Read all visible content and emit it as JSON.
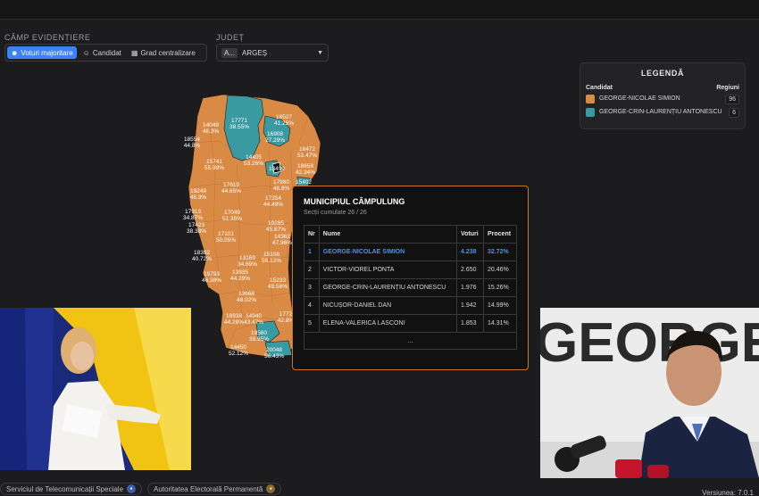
{
  "controls": {
    "camp_label": "CÂMP EVIDENȚIERE",
    "options": [
      {
        "label": "Voturi majoritare",
        "icon": "people-icon",
        "active": true
      },
      {
        "label": "Candidat",
        "icon": "person-icon",
        "active": false
      },
      {
        "label": "Grad centralizare",
        "icon": "calendar-icon",
        "active": false
      }
    ],
    "judet_label": "JUDEȚ",
    "judet_code": "A...",
    "judet_value": "ARGEȘ"
  },
  "legend": {
    "title": "LEGENDĂ",
    "col_candidate": "Candidat",
    "col_regions": "Regiuni",
    "items": [
      {
        "name": "GEORGE-NICOLAE SIMION",
        "count": "96",
        "color": "#d98a45"
      },
      {
        "name": "GEORGE-CRIN-LAURENȚIU ANTONESCU",
        "count": "6",
        "color": "#3a9aa2"
      }
    ]
  },
  "map_labels": [
    {
      "v": "14049",
      "p": "48.3%"
    },
    {
      "v": "17771",
      "p": "38.55%"
    },
    {
      "v": "18527",
      "p": "41.25%"
    },
    {
      "v": "18554",
      "p": "44.8%"
    },
    {
      "v": "16908",
      "p": "27.29%"
    },
    {
      "v": "16472",
      "p": "53.47%"
    },
    {
      "v": "15741",
      "p": "55.99%"
    },
    {
      "v": "14405",
      "p": "53.26%"
    },
    {
      "v": "13490",
      "p": ""
    },
    {
      "v": "18658",
      "p": "42.34%"
    },
    {
      "v": "17619",
      "p": "44.65%"
    },
    {
      "v": "17960",
      "p": "46.8%"
    },
    {
      "v": "15402",
      "p": ""
    },
    {
      "v": "19249",
      "p": "48.9%"
    },
    {
      "v": "17254",
      "p": "44.49%"
    },
    {
      "v": "17913",
      "p": "34.87%"
    },
    {
      "v": "17049",
      "p": "51.35%"
    },
    {
      "v": "19285",
      "p": "45.67%"
    },
    {
      "v": "17423",
      "p": "38.38%"
    },
    {
      "v": "17101",
      "p": "50.05%"
    },
    {
      "v": "14362",
      "p": "47.96%"
    },
    {
      "v": "18392",
      "p": "40.72%"
    },
    {
      "v": "13169",
      "p": "34.69%"
    },
    {
      "v": "15108",
      "p": "56.12%"
    },
    {
      "v": "19793",
      "p": "46.38%"
    },
    {
      "v": "13935",
      "p": "44.29%"
    },
    {
      "v": "15233",
      "p": "49.56%"
    },
    {
      "v": "13668",
      "p": "48.02%"
    },
    {
      "v": "18938",
      "p": "44.28%"
    },
    {
      "v": "14940",
      "p": "43.47%"
    },
    {
      "v": "1772",
      "p": "42.8%"
    },
    {
      "v": "19560",
      "p": "39.95%"
    },
    {
      "v": "14450",
      "p": "52.12%"
    },
    {
      "v": "20048",
      "p": "56.43%"
    }
  ],
  "tooltip": {
    "title": "MUNICIPIUL CÂMPULUNG",
    "subtitle": "Secții cumulate 26 / 26",
    "headers": {
      "nr": "Nr",
      "name": "Nume",
      "votes": "Voturi",
      "percent": "Procent"
    },
    "rows": [
      {
        "nr": "1",
        "name": "GEORGE-NICOLAE SIMION",
        "votes": "4.238",
        "percent": "32.72%"
      },
      {
        "nr": "2",
        "name": "VICTOR-VIOREL PONTA",
        "votes": "2.650",
        "percent": "20.46%"
      },
      {
        "nr": "3",
        "name": "GEORGE-CRIN-LAURENȚIU ANTONESCU",
        "votes": "1.976",
        "percent": "15.26%"
      },
      {
        "nr": "4",
        "name": "NICUȘOR-DANIEL DAN",
        "votes": "1.942",
        "percent": "14.99%"
      },
      {
        "nr": "5",
        "name": "ELENA-VALERICA LASCONI",
        "votes": "1.853",
        "percent": "14.31%"
      }
    ],
    "more": "..."
  },
  "photos": {
    "right_backdrop_text": "GEORGE SIMION"
  },
  "footer": {
    "chip1": "Serviciul de Telecomunicații Speciale",
    "chip2": "Autoritatea Electorală Permanentă",
    "version": "Versiunea: 7.0.1"
  },
  "colors": {
    "simion": "#d98a45",
    "antonescu": "#3a9aa2",
    "accent": "#3b82f6",
    "tooltip_border": "#c8752a"
  }
}
